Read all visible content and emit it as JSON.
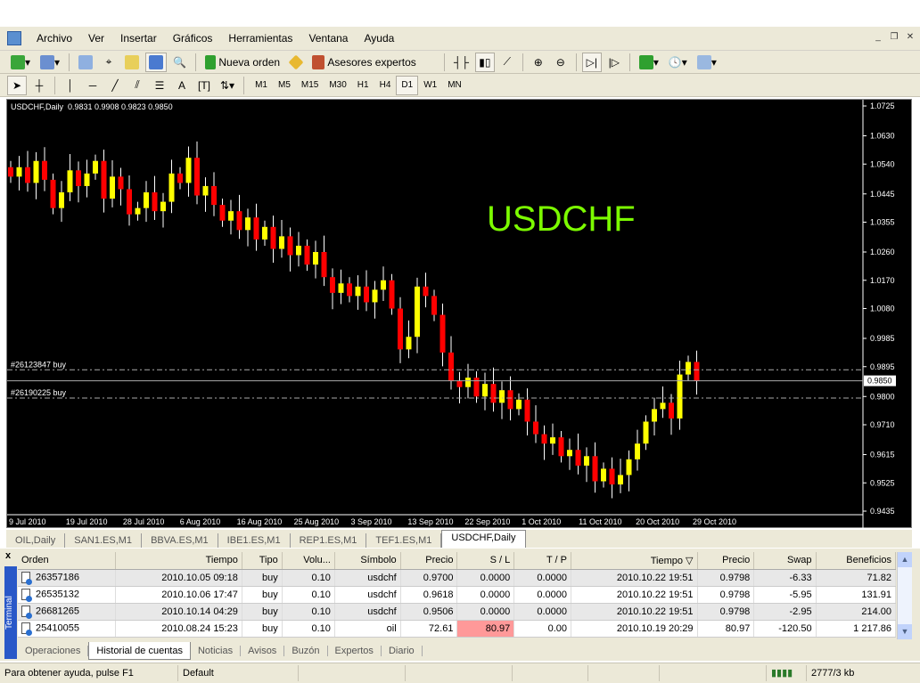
{
  "menu": [
    "Archivo",
    "Ver",
    "Insertar",
    "Gráficos",
    "Herramientas",
    "Ventana",
    "Ayuda"
  ],
  "toolbar": {
    "new_order": "Nueva orden",
    "experts": "Asesores expertos"
  },
  "draw_tools": {
    "text": "A"
  },
  "timeframes": [
    "M1",
    "M5",
    "M15",
    "M30",
    "H1",
    "H4",
    "D1",
    "W1",
    "MN"
  ],
  "active_timeframe": "D1",
  "chart": {
    "header": "USDCHF,Daily  0.9831 0.9908 0.9823 0.9850",
    "big_symbol": "USDCHF",
    "price_ticks": [
      "1.0725",
      "1.0630",
      "1.0540",
      "1.0445",
      "1.0355",
      "1.0260",
      "1.0170",
      "1.0080",
      "0.9985",
      "0.9895",
      "0.9800",
      "0.9710",
      "0.9615",
      "0.9525",
      "0.9435"
    ],
    "current_price": "0.9850",
    "date_ticks": [
      "9 Jul 2010",
      "19 Jul 2010",
      "28 Jul 2010",
      "6 Aug 2010",
      "16 Aug 2010",
      "25 Aug 2010",
      "3 Sep 2010",
      "13 Sep 2010",
      "22 Sep 2010",
      "1 Oct 2010",
      "11 Oct 2010",
      "20 Oct 2010",
      "29 Oct 2010"
    ],
    "orders": [
      {
        "label": "#26123847 buy",
        "price": 0.9885
      },
      {
        "label": "#26190225 buy",
        "price": 0.9795
      }
    ],
    "closes": [
      1.05,
      1.053,
      1.048,
      1.055,
      1.049,
      1.04,
      1.045,
      1.052,
      1.047,
      1.051,
      1.055,
      1.043,
      1.05,
      1.046,
      1.038,
      1.04,
      1.045,
      1.039,
      1.042,
      1.051,
      1.048,
      1.056,
      1.044,
      1.047,
      1.041,
      1.036,
      1.039,
      1.033,
      1.037,
      1.03,
      1.034,
      1.027,
      1.031,
      1.025,
      1.028,
      1.022,
      1.026,
      1.018,
      1.013,
      1.016,
      1.012,
      1.015,
      1.01,
      1.014,
      1.017,
      1.008,
      0.995,
      0.999,
      1.015,
      1.012,
      1.006,
      0.994,
      0.985,
      0.983,
      0.986,
      0.98,
      0.984,
      0.978,
      0.982,
      0.976,
      0.979,
      0.972,
      0.968,
      0.965,
      0.967,
      0.961,
      0.963,
      0.958,
      0.961,
      0.953,
      0.957,
      0.952,
      0.955,
      0.96,
      0.965,
      0.972,
      0.976,
      0.978,
      0.973,
      0.987,
      0.991,
      0.985
    ]
  },
  "tabs": [
    "OIL,Daily",
    "SAN1.ES,M1",
    "BBVA.ES,M1",
    "IBE1.ES,M1",
    "REP1.ES,M1",
    "TEF1.ES,M1",
    "USDCHF,Daily"
  ],
  "terminal": {
    "label": "Terminal",
    "close": "x",
    "columns": [
      "Orden",
      "Tiempo",
      "Tipo",
      "Volu...",
      "Símbolo",
      "Precio",
      "S / L",
      "T / P",
      "Tiempo ▽",
      "Precio",
      "Swap",
      "Beneficios"
    ],
    "rows": [
      [
        "26357186",
        "2010.10.05 09:18",
        "buy",
        "0.10",
        "usdchf",
        "0.9700",
        "0.0000",
        "0.0000",
        "2010.10.22 19:51",
        "0.9798",
        "-6.33",
        "71.82"
      ],
      [
        "26535132",
        "2010.10.06 17:47",
        "buy",
        "0.10",
        "usdchf",
        "0.9618",
        "0.0000",
        "0.0000",
        "2010.10.22 19:51",
        "0.9798",
        "-5.95",
        "131.91"
      ],
      [
        "26681265",
        "2010.10.14 04:29",
        "buy",
        "0.10",
        "usdchf",
        "0.9506",
        "0.0000",
        "0.0000",
        "2010.10.22 19:51",
        "0.9798",
        "-2.95",
        "214.00"
      ],
      [
        "25410055",
        "2010.08.24 15:23",
        "buy",
        "0.10",
        "oil",
        "72.61",
        "80.97",
        "0.00",
        "2010.10.19 20:29",
        "80.97",
        "-120.50",
        "1 217.86"
      ]
    ],
    "tabs": [
      "Operaciones",
      "Historial de cuentas",
      "Noticias",
      "Avisos",
      "Buzón",
      "Expertos",
      "Diario"
    ],
    "active_tab": "Historial de cuentas"
  },
  "status": {
    "help": "Para obtener ayuda, pulse F1",
    "profile": "Default",
    "traffic": "2777/3 kb"
  },
  "colors": {
    "bull": "#ffff00",
    "bear": "#ff0000",
    "symbol": "#7cfc00",
    "sl_hit": "#ff9999"
  }
}
